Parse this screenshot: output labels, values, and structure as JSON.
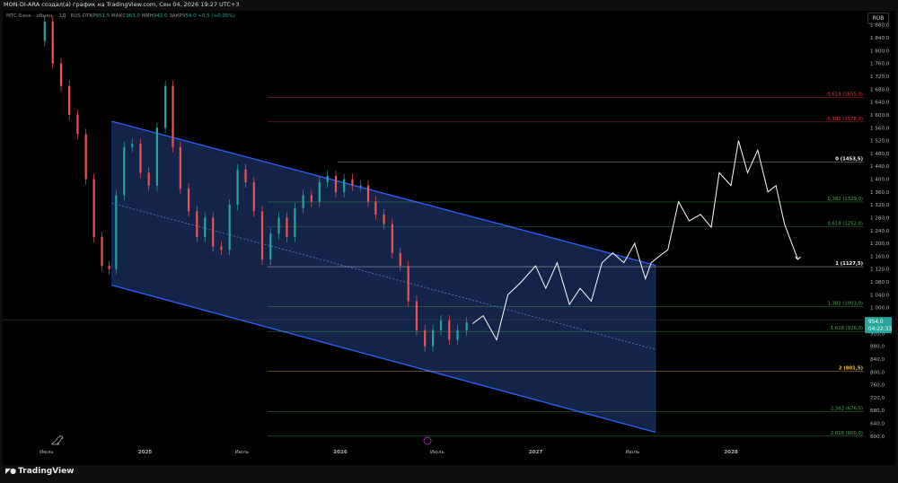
{
  "header": {
    "note": "MON-DI-ARA создал(а) график на TradingView.com, Сен 04, 2026 19:27 UTC+3"
  },
  "legend": {
    "title": "МТС-Банк - обыкн. · 1Д · RUS",
    "o_label": "ОТКР",
    "o_val": "951,5",
    "h_label": "МАКС",
    "h_val": "963,0",
    "l_label": "МИН",
    "l_val": "942,0",
    "c_label": "ЗАКР",
    "c_val": "954,0",
    "change": "+0,5 (+0,05%)"
  },
  "currency": "RUB",
  "brand": "TradingView",
  "colors": {
    "background": "#000000",
    "channel_fill": "#162750",
    "channel_line": "#2962ff",
    "up_candle": "#26a69a",
    "down_candle": "#ef5350",
    "projection": "#ffffff",
    "fib_red": "#f23645",
    "fib_green": "#4caf50",
    "fib_white": "#ffffff",
    "fib_yellow": "#f6c244",
    "price_badge": "#26a69a"
  },
  "chart_data": {
    "type": "line",
    "y_scale": "linear",
    "ylim": [
      580,
      1910
    ],
    "x_range": [
      "2024-04-10",
      "2028-09-07"
    ],
    "price_ticks": [
      "1 880,0",
      "1 840,0",
      "1 800,0",
      "1 760,0",
      "1 720,0",
      "1 680,0",
      "1 640,0",
      "1 600,0",
      "1 560,0",
      "1 520,0",
      "1 480,0",
      "1 440,0",
      "1 400,0",
      "1 360,0",
      "1 320,0",
      "1 280,0",
      "1 240,0",
      "1 200,0",
      "1 160,0",
      "1 120,0",
      "1 080,0",
      "1 040,0",
      "1 000,0",
      "960,0",
      "920,0",
      "880,0",
      "840,0",
      "800,0",
      "760,0",
      "720,0",
      "680,0",
      "640,0",
      "600,0"
    ],
    "price_tick_values": [
      1880,
      1840,
      1800,
      1760,
      1720,
      1680,
      1640,
      1600,
      1560,
      1520,
      1480,
      1440,
      1400,
      1360,
      1320,
      1280,
      1240,
      1200,
      1160,
      1120,
      1080,
      1040,
      1000,
      960,
      920,
      880,
      840,
      800,
      760,
      720,
      680,
      640,
      600
    ],
    "time_ticks": [
      {
        "label": "Июль",
        "date": "2024-07-01"
      },
      {
        "label": "2025",
        "date": "2025-01-01"
      },
      {
        "label": "Июль",
        "date": "2025-07-01"
      },
      {
        "label": "2026",
        "date": "2026-01-01"
      },
      {
        "label": "Июль",
        "date": "2026-07-01"
      },
      {
        "label": "2027",
        "date": "2027-01-01"
      },
      {
        "label": "Июль",
        "date": "2027-07-01"
      },
      {
        "label": "2028",
        "date": "2028-01-01"
      }
    ],
    "last_price": {
      "value": 954.0,
      "label": "954,0",
      "countdown": "04:22:33"
    },
    "fib_levels": [
      {
        "label": "-0,618 (1655,0)",
        "value": 1655.0,
        "color": "#f23645",
        "bold": false
      },
      {
        "label": "-0,382 (1578,0)",
        "value": 1578.0,
        "color": "#f23645",
        "bold": false
      },
      {
        "label": "0 (1453,5)",
        "value": 1453.5,
        "color": "#ffffff",
        "bold": true
      },
      {
        "label": "0,382 (1329,0)",
        "value": 1329.0,
        "color": "#4caf50",
        "bold": false
      },
      {
        "label": "0,618 (1252,0)",
        "value": 1252.0,
        "color": "#4caf50",
        "bold": false
      },
      {
        "label": "1 (1127,5)",
        "value": 1127.5,
        "color": "#ffffff",
        "bold": true
      },
      {
        "label": "1,382 (1003,0)",
        "value": 1003.0,
        "color": "#4caf50",
        "bold": false
      },
      {
        "label": "1,618 (926,0)",
        "value": 926.0,
        "color": "#4caf50",
        "bold": false
      },
      {
        "label": "2 (801,5)",
        "value": 801.5,
        "color": "#f6c244",
        "bold": true
      },
      {
        "label": "2,382 (676,5)",
        "value": 676.5,
        "color": "#4caf50",
        "bold": false
      },
      {
        "label": "2,618 (600,0)",
        "value": 600.0,
        "color": "#4caf50",
        "bold": false
      }
    ],
    "channel": {
      "upper": [
        {
          "x": "2024-10-31",
          "y": 1580
        },
        {
          "x": "2027-08-13",
          "y": 1132
        }
      ],
      "lower": [
        {
          "x": "2024-10-31",
          "y": 1070
        },
        {
          "x": "2027-08-13",
          "y": 612
        }
      ],
      "mid": [
        {
          "x": "2024-10-31",
          "y": 1325
        },
        {
          "x": "2027-08-13",
          "y": 870
        }
      ]
    },
    "price_series": {
      "name": "",
      "x": [
        "2024-06-20",
        "2024-07-05",
        "2024-07-20",
        "2024-08-05",
        "2024-08-20",
        "2024-09-05",
        "2024-09-20",
        "2024-10-05",
        "2024-10-20",
        "2024-11-01",
        "2024-11-15",
        "2024-12-01",
        "2024-12-15",
        "2025-01-01",
        "2025-01-15",
        "2025-02-01",
        "2025-02-15",
        "2025-03-01",
        "2025-03-15",
        "2025-04-01",
        "2025-04-15",
        "2025-05-01",
        "2025-05-15",
        "2025-06-01",
        "2025-06-15",
        "2025-07-01",
        "2025-07-15",
        "2025-08-01",
        "2025-08-15",
        "2025-09-01",
        "2025-09-15",
        "2025-10-01",
        "2025-10-15",
        "2025-11-01",
        "2025-11-15",
        "2025-12-01",
        "2025-12-15",
        "2026-01-01",
        "2026-01-15",
        "2026-02-01",
        "2026-02-15",
        "2026-03-01",
        "2026-03-15",
        "2026-04-01",
        "2026-04-15",
        "2026-05-01",
        "2026-05-15",
        "2026-06-01",
        "2026-06-15",
        "2026-07-01",
        "2026-07-15",
        "2026-08-01",
        "2026-08-15",
        "2026-09-04"
      ],
      "y": [
        1830,
        1890,
        1760,
        1690,
        1600,
        1540,
        1400,
        1220,
        1130,
        1120,
        1350,
        1500,
        1510,
        1420,
        1380,
        1560,
        1690,
        1500,
        1370,
        1300,
        1220,
        1280,
        1190,
        1180,
        1320,
        1430,
        1390,
        1300,
        1150,
        1230,
        1280,
        1220,
        1310,
        1350,
        1330,
        1390,
        1410,
        1360,
        1400,
        1380,
        1380,
        1330,
        1290,
        1260,
        1170,
        1130,
        1020,
        930,
        880,
        930,
        960,
        900,
        930,
        954
      ]
    },
    "projection": {
      "name": "",
      "x": [
        "2026-09-05",
        "2026-09-25",
        "2026-10-20",
        "2026-11-10",
        "2026-12-05",
        "2027-01-01",
        "2027-01-20",
        "2027-02-10",
        "2027-03-05",
        "2027-03-25",
        "2027-04-15",
        "2027-05-05",
        "2027-05-25",
        "2027-06-15",
        "2027-07-05",
        "2027-07-25",
        "2027-08-05",
        "2027-08-20",
        "2027-09-05",
        "2027-09-25",
        "2027-10-15",
        "2027-11-05",
        "2027-11-25",
        "2027-12-10",
        "2028-01-01",
        "2028-01-15",
        "2028-02-01",
        "2028-02-20",
        "2028-03-10",
        "2028-03-25",
        "2028-04-10",
        "2028-05-05"
      ],
      "y": [
        950,
        975,
        900,
        1040,
        1080,
        1130,
        1060,
        1140,
        1010,
        1060,
        1020,
        1140,
        1170,
        1140,
        1200,
        1090,
        1140,
        1160,
        1180,
        1330,
        1270,
        1290,
        1250,
        1420,
        1380,
        1520,
        1420,
        1490,
        1360,
        1380,
        1260,
        1150
      ]
    }
  }
}
